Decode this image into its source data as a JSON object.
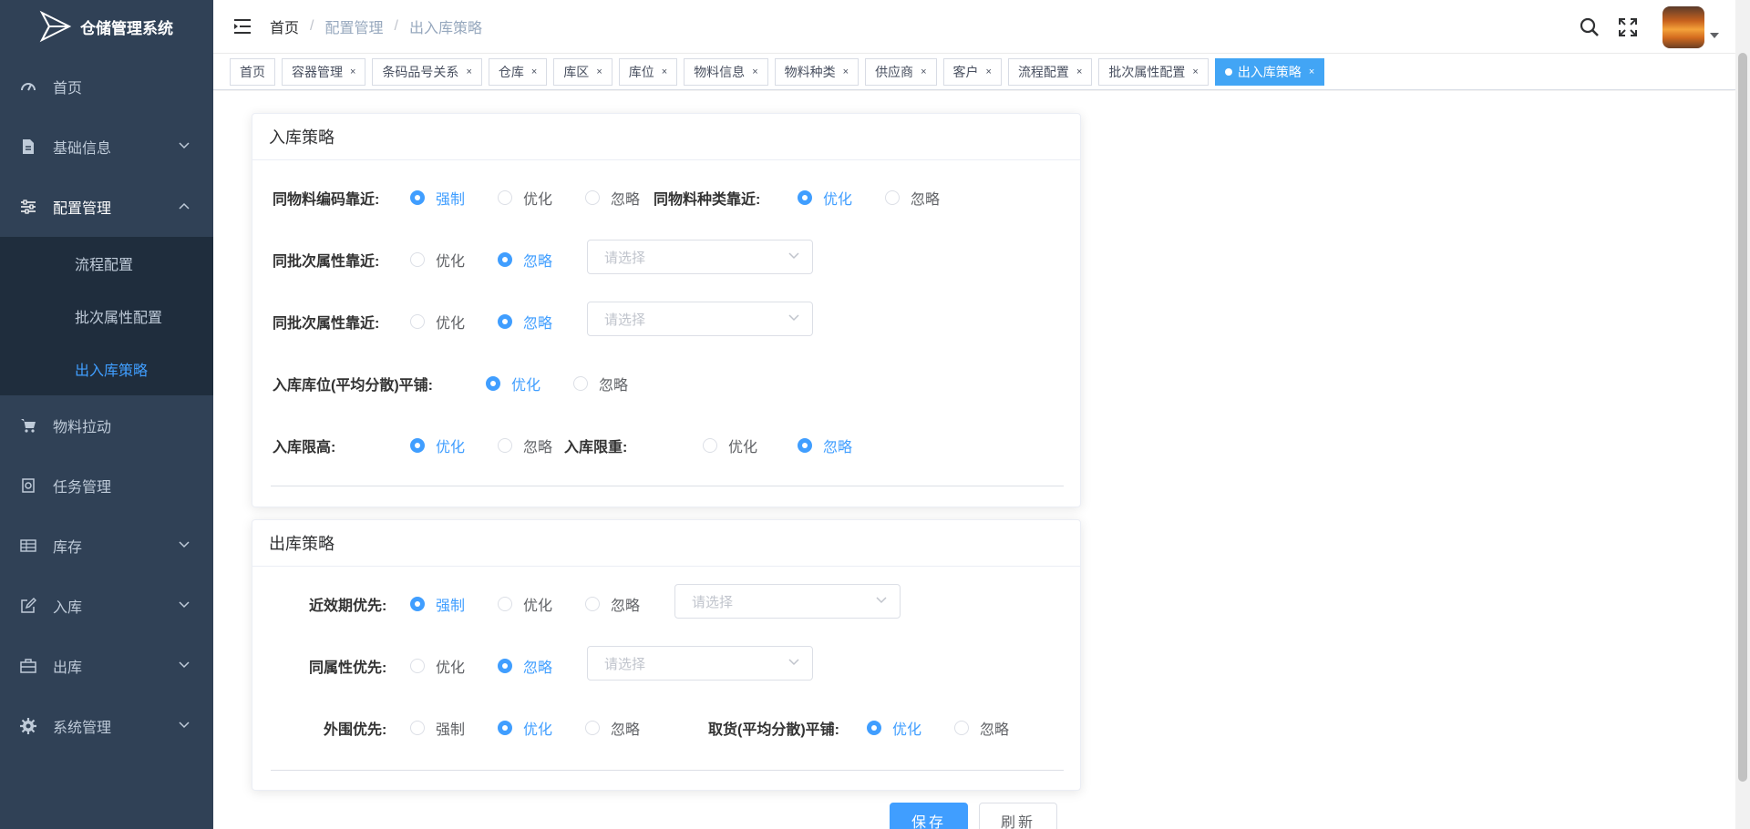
{
  "app": {
    "title": "仓储管理系统"
  },
  "sidebar": {
    "menu": [
      {
        "label": "首页",
        "icon": "dashboard-icon"
      },
      {
        "label": "基础信息",
        "icon": "document-icon"
      },
      {
        "label": "配置管理",
        "icon": "sliders-icon"
      },
      {
        "label": "物料拉动",
        "icon": "cart-icon"
      },
      {
        "label": "任务管理",
        "icon": "task-icon"
      },
      {
        "label": "库存",
        "icon": "table-icon"
      },
      {
        "label": "入库",
        "icon": "edit-icon"
      },
      {
        "label": "出库",
        "icon": "briefcase-icon"
      },
      {
        "label": "系统管理",
        "icon": "gear-icon"
      }
    ],
    "submenu": [
      {
        "label": "流程配置"
      },
      {
        "label": "批次属性配置"
      },
      {
        "label": "出入库策略"
      }
    ]
  },
  "breadcrumb": [
    "首页",
    "配置管理",
    "出入库策略"
  ],
  "tags": [
    {
      "label": "首页"
    },
    {
      "label": "容器管理"
    },
    {
      "label": "条码品号关系"
    },
    {
      "label": "仓库"
    },
    {
      "label": "库区"
    },
    {
      "label": "库位"
    },
    {
      "label": "物料信息"
    },
    {
      "label": "物料种类"
    },
    {
      "label": "供应商"
    },
    {
      "label": "客户"
    },
    {
      "label": "流程配置"
    },
    {
      "label": "批次属性配置"
    },
    {
      "label": "出入库策略"
    }
  ],
  "close_glyph": "×",
  "opts": {
    "force": "强制",
    "optimize": "优化",
    "ignore": "忽略"
  },
  "select_placeholder": "请选择",
  "inbound": {
    "title": "入库策略",
    "same_code": "同物料编码靠近:",
    "same_kind": "同物料种类靠近:",
    "same_batch1": "同批次属性靠近:",
    "same_batch2": "同批次属性靠近:",
    "spread": "入库库位(平均分散)平铺:",
    "height": "入库限高:",
    "weight": "入库限重:"
  },
  "outbound": {
    "title": "出库策略",
    "expiry": "近效期优先:",
    "same_attr": "同属性优先:",
    "periphery": "外围优先:",
    "pick_spread": "取货(平均分散)平铺:"
  },
  "buttons": {
    "save": "保存",
    "refresh": "刷新"
  },
  "colors": {
    "sidebar_bg": "#304156",
    "accent": "#409eff",
    "active_tag": "#42a5f5"
  }
}
